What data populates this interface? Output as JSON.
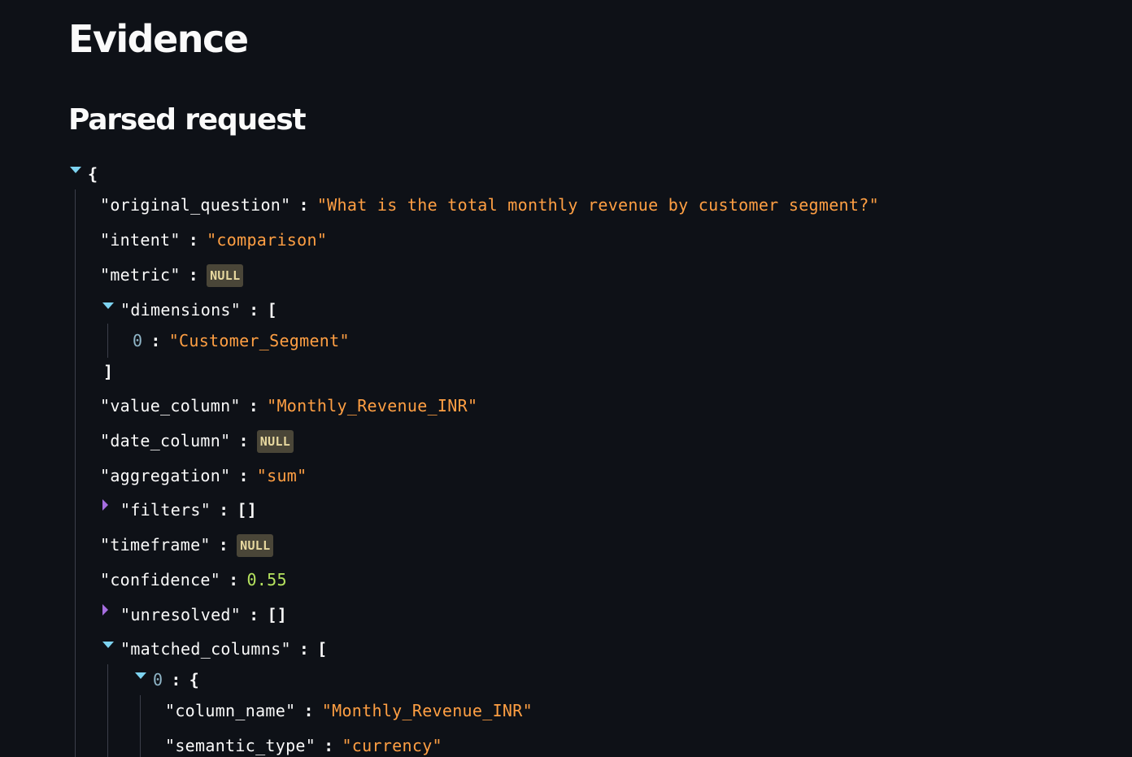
{
  "page": {
    "title": "Evidence",
    "section_title": "Parsed request"
  },
  "json_tree": {
    "root_open": "{",
    "original_question": {
      "key": "\"original_question\"",
      "value": "\"What is the total monthly revenue by customer segment?\""
    },
    "intent": {
      "key": "\"intent\"",
      "value": "\"comparison\""
    },
    "metric": {
      "key": "\"metric\"",
      "value": "NULL"
    },
    "dimensions": {
      "key": "\"dimensions\"",
      "open": "[",
      "items": [
        {
          "index": "0",
          "value": "\"Customer_Segment\""
        }
      ],
      "close": "]"
    },
    "value_column": {
      "key": "\"value_column\"",
      "value": "\"Monthly_Revenue_INR\""
    },
    "date_column": {
      "key": "\"date_column\"",
      "value": "NULL"
    },
    "aggregation": {
      "key": "\"aggregation\"",
      "value": "\"sum\""
    },
    "filters": {
      "key": "\"filters\"",
      "value": "[]"
    },
    "timeframe": {
      "key": "\"timeframe\"",
      "value": "NULL"
    },
    "confidence": {
      "key": "\"confidence\"",
      "value": "0.55"
    },
    "unresolved": {
      "key": "\"unresolved\"",
      "value": "[]"
    },
    "matched_columns": {
      "key": "\"matched_columns\"",
      "open": "[",
      "items": [
        {
          "index": "0",
          "open": "{",
          "column_name": {
            "key": "\"column_name\"",
            "value": "\"Monthly_Revenue_INR\""
          },
          "semantic_type": {
            "key": "\"semantic_type\"",
            "value": "\"currency\""
          }
        }
      ]
    },
    "colon": ":"
  },
  "colors": {
    "background": "#0e1117",
    "string": "#ff9f43",
    "number": "#b6e35f",
    "expand_open": "#7dd3f0",
    "expand_closed": "#a66ee0"
  }
}
